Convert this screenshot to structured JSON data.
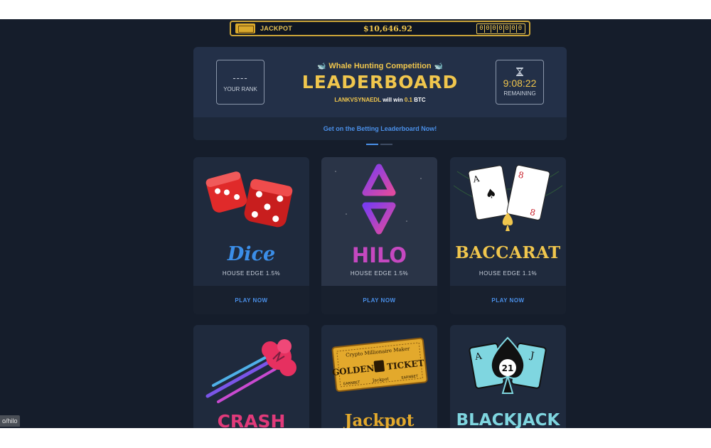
{
  "jackpot": {
    "label": "JACKPOT",
    "amount": "$10,646.92",
    "digits": [
      "0",
      "0",
      "0",
      "0",
      "0",
      "0",
      "0"
    ],
    "accent": "#f0c64d"
  },
  "leaderboard": {
    "your_rank_value": "----",
    "your_rank_label": "YOUR RANK",
    "competition": "Whale Hunting Competition",
    "title": "LEADERBOARD",
    "winner_name": "LANKVSYNAEDL",
    "winner_text": "will win",
    "winner_amount": "0.1",
    "winner_currency": "BTC",
    "time_value": "9:08:22",
    "time_label": "REMAINING",
    "cta": "Get on the Betting Leaderboard Now!"
  },
  "games": [
    {
      "name": "Dice",
      "edge": "HOUSE EDGE 1.5%",
      "play": "PLAY NOW",
      "color": "#3b8ee8"
    },
    {
      "name": "HILO",
      "edge": "HOUSE EDGE 1.5%",
      "play": "PLAY NOW",
      "color": "#c548c0"
    },
    {
      "name": "BACCARAT",
      "edge": "HOUSE EDGE 1.1%",
      "play": "PLAY NOW",
      "color": "#f0c64d"
    },
    {
      "name": "CRASH",
      "color": "#e03a7a"
    },
    {
      "name": "Jackpot",
      "color": "#e3a92c",
      "ticket_line1": "Crypto Millionaire Maker",
      "ticket_left": "GOLDEN",
      "ticket_right": "TICKET",
      "ticket_small1": "EARNBET",
      "ticket_small2": "Jackpot",
      "ticket_small3": "EARNBET"
    },
    {
      "name": "BLACKJACK",
      "color": "#7fd6e0",
      "card_left": "A",
      "card_right": "J",
      "badge": "21"
    }
  ],
  "status_url": "o/hilo"
}
